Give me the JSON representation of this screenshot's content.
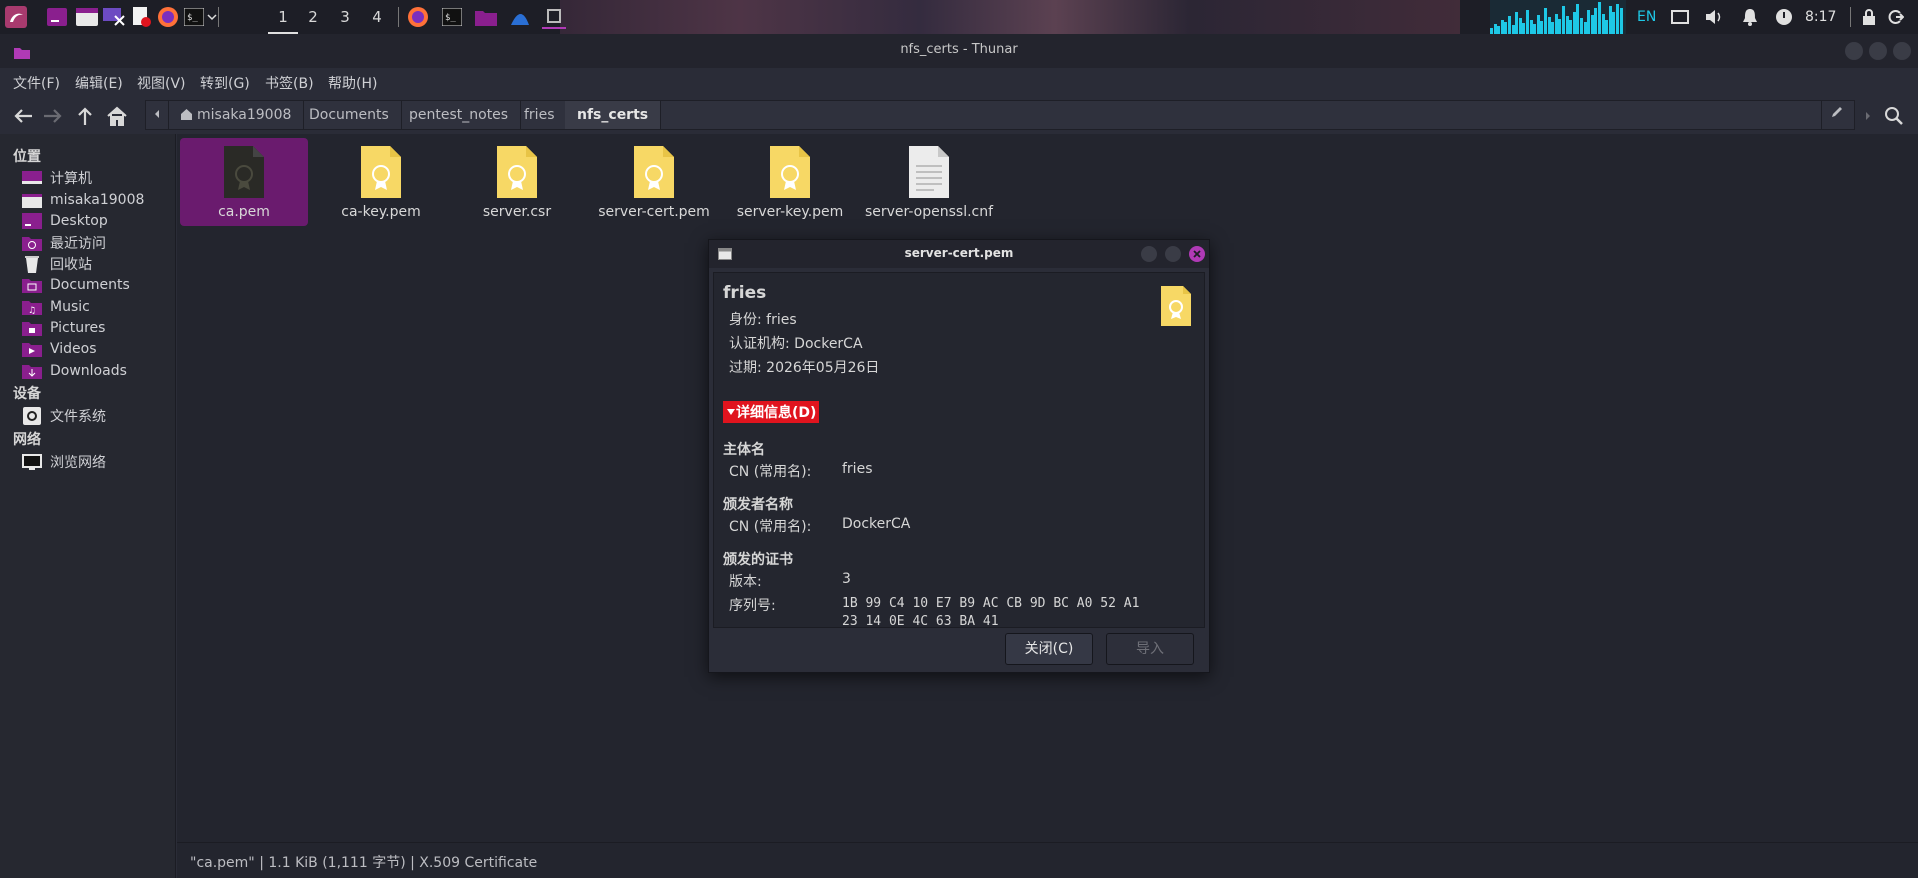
{
  "panel": {
    "workspaces": [
      "1",
      "2",
      "3",
      "4"
    ],
    "keyboard_layout": "EN",
    "clock": "8:17"
  },
  "window": {
    "title": "nfs_certs - Thunar"
  },
  "menubar": {
    "items": [
      "文件(F)",
      "编辑(E)",
      "视图(V)",
      "转到(G)",
      "书签(B)",
      "帮助(H)"
    ]
  },
  "pathbar": {
    "crumbs": [
      "misaka19008",
      "Documents",
      "pentest_notes",
      "fries",
      "nfs_certs"
    ]
  },
  "sidebar": {
    "places_header": "位置",
    "places": [
      "计算机",
      "misaka19008",
      "Desktop",
      "最近访问",
      "回收站",
      "Documents",
      "Music",
      "Pictures",
      "Videos",
      "Downloads"
    ],
    "devices_header": "设备",
    "devices": [
      "文件系统"
    ],
    "network_header": "网络",
    "network": [
      "浏览网络"
    ]
  },
  "files": [
    {
      "name": "ca.pem",
      "icon": "certificate-icon",
      "selected": true
    },
    {
      "name": "ca-key.pem",
      "icon": "certificate-icon"
    },
    {
      "name": "server.csr",
      "icon": "certificate-icon"
    },
    {
      "name": "server-cert.pem",
      "icon": "certificate-icon"
    },
    {
      "name": "server-key.pem",
      "icon": "certificate-icon"
    },
    {
      "name": "server-openssl.cnf",
      "icon": "text-file-icon"
    }
  ],
  "status": {
    "text": "\"ca.pem\" | 1.1 KiB (1,111 字节) | X.509 Certificate"
  },
  "dialog": {
    "title": "server-cert.pem",
    "cert_name": "fries",
    "identity": "身份: fries",
    "issuer": "认证机构: DockerCA",
    "expires": "过期: 2026年05月26日",
    "details_toggle": "详细信息(D)",
    "subject_header": "主体名",
    "subject_cn_label": "CN (常用名):",
    "subject_cn_value": "fries",
    "issuer_header": "颁发者名称",
    "issuer_cn_label": "CN (常用名):",
    "issuer_cn_value": "DockerCA",
    "cert_header": "颁发的证书",
    "version_label": "版本:",
    "version_value": "3",
    "serial_label": "序列号:",
    "serial_line1": "1B 99 C4 10 E7 B9 AC CB 9D BC A0 52 A1",
    "serial_line2": "23 14 0E 4C 63 BA 41",
    "close_button": "关闭(C)",
    "import_button": "导入"
  }
}
